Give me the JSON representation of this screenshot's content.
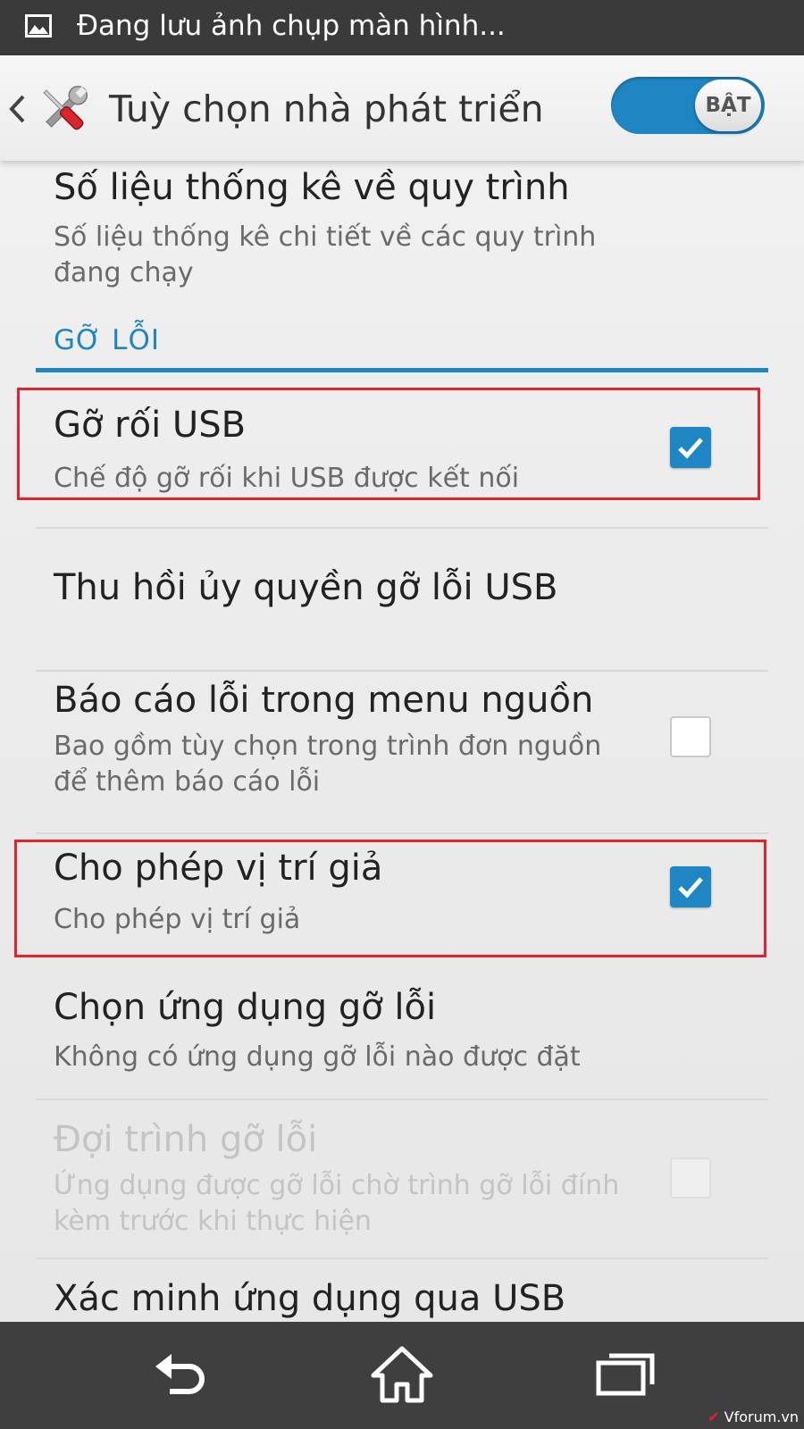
{
  "status_bar": {
    "notification_icon": "image-icon",
    "text": "Đang lưu ảnh chụp màn hình..."
  },
  "action_bar": {
    "back_icon": "chevron-left-icon",
    "app_icon": "tools-icon",
    "title": "Tuỳ chọn nhà phát triển",
    "toggle_label": "BẬT",
    "toggle_state": "on"
  },
  "items_top": {
    "process_stats": {
      "title": "Số liệu thống kê về quy trình",
      "summary": "Số liệu thống kê chi tiết về các quy trình đang chạy"
    }
  },
  "section": {
    "label": "GỠ LỖI"
  },
  "items": {
    "usb_debugging": {
      "title": "Gỡ rối USB",
      "summary": "Chế độ gỡ rối khi USB được kết nối",
      "checked": true
    },
    "revoke_usb_auth": {
      "title": "Thu hồi ủy quyền gỡ lỗi USB"
    },
    "bug_report_menu": {
      "title": "Báo cáo lỗi trong menu nguồn",
      "summary": "Bao gồm tùy chọn trong trình đơn nguồn để thêm báo cáo lỗi",
      "checked": false
    },
    "mock_locations": {
      "title": "Cho phép vị trí giả",
      "summary": "Cho phép vị trí giả",
      "checked": true
    },
    "debug_app": {
      "title": "Chọn ứng dụng gỡ lỗi",
      "summary": "Không có ứng dụng gỡ lỗi nào được đặt"
    },
    "wait_debugger": {
      "title": "Đợi trình gỡ lỗi",
      "summary": "Ứng dụng được gỡ lỗi chờ trình gỡ lỗi đính kèm trước khi thực hiện",
      "checked": false,
      "enabled": false
    },
    "verify_usb_apps": {
      "title": "Xác minh ứng dụng qua USB"
    }
  },
  "nav_bar": {
    "back": "back-icon",
    "home": "home-icon",
    "recents": "recents-icon"
  },
  "watermark": {
    "text": "Vforum.vn"
  },
  "colors": {
    "accent": "#1e86c3",
    "highlight": "#e0232d",
    "status_bar": "#3a3a3a",
    "nav_bar": "#3f3f3f"
  }
}
